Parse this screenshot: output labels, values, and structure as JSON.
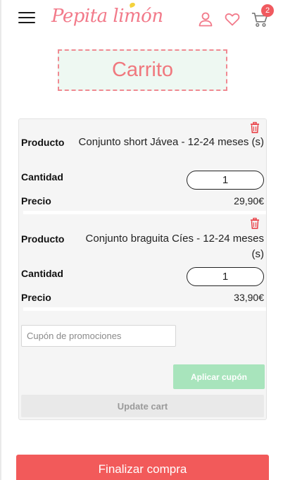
{
  "header": {
    "logo_text": "Pepita limón",
    "cart_count": "2",
    "icons": [
      "menu-icon",
      "user-icon",
      "heart-icon",
      "cart-icon"
    ],
    "accent_color": "#f27a8a"
  },
  "page": {
    "title": "Carrito"
  },
  "cart": {
    "items": [
      {
        "product_label": "Producto",
        "product_name": "Conjunto short Jávea - 12-24 meses (s)",
        "quantity_label": "Cantidad",
        "quantity": "1",
        "price_label": "Precio",
        "price": "29,90€"
      },
      {
        "product_label": "Producto",
        "product_name": "Conjunto braguita Cíes - 12-24 meses (s)",
        "quantity_label": "Cantidad",
        "quantity": "1",
        "price_label": "Precio",
        "price": "33,90€"
      }
    ],
    "coupon_placeholder": "Cupón de promociones",
    "apply_coupon_label": "Aplicar cupón",
    "update_cart_label": "Update cart"
  },
  "checkout": {
    "label": "Finalizar compra",
    "color": "#f25a5a"
  }
}
